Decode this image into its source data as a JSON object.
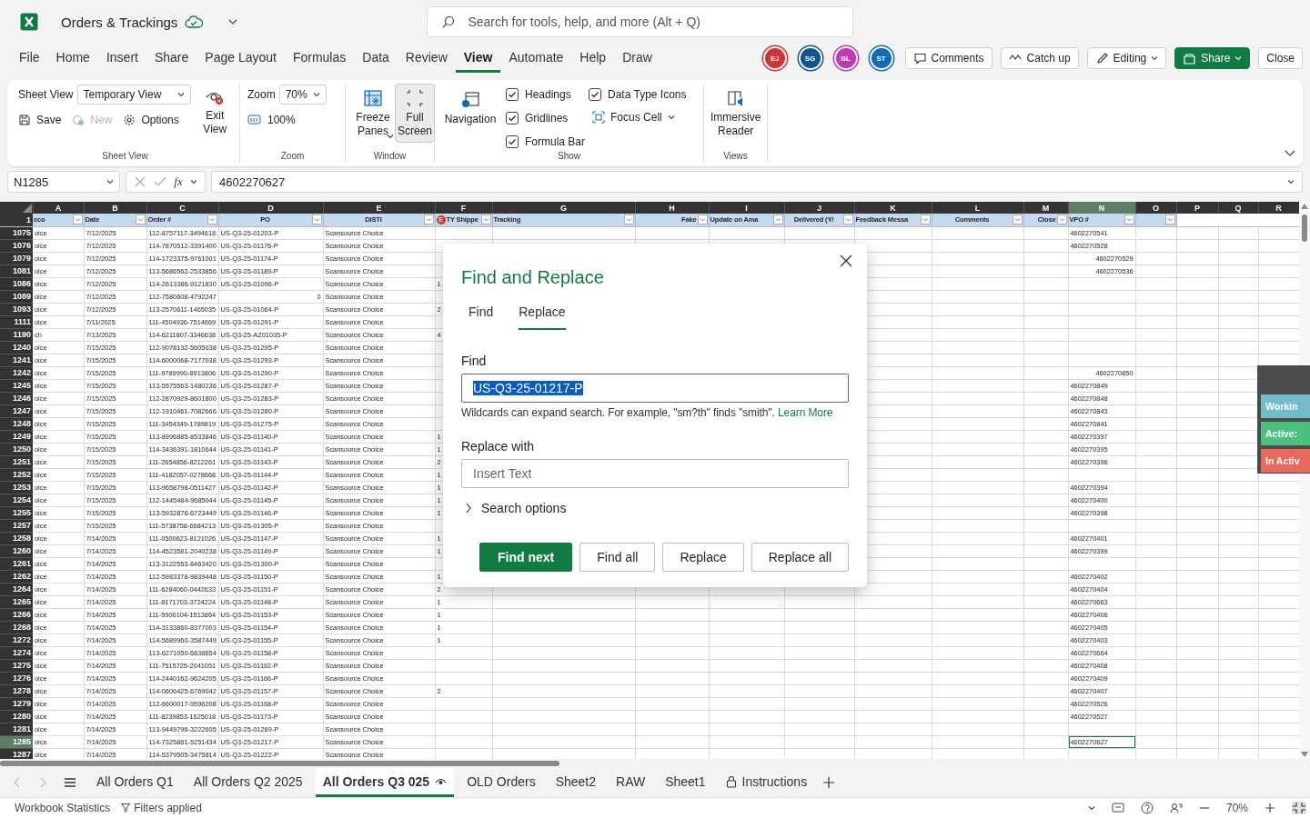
{
  "app_bar": {
    "title": "Orders & Trackings",
    "search": {
      "placeholder": "Search for tools, help, and more (Alt + Q)"
    }
  },
  "menu": [
    {
      "label": "File",
      "selected": false
    },
    {
      "label": "Home",
      "selected": false
    },
    {
      "label": "Insert",
      "selected": false
    },
    {
      "label": "Share",
      "selected": false
    },
    {
      "label": "Page Layout",
      "selected": false
    },
    {
      "label": "Formulas",
      "selected": false
    },
    {
      "label": "Data",
      "selected": false
    },
    {
      "label": "Review",
      "selected": false
    },
    {
      "label": "View",
      "selected": true
    },
    {
      "label": "Automate",
      "selected": false
    },
    {
      "label": "Help",
      "selected": false
    },
    {
      "label": "Draw",
      "selected": false
    }
  ],
  "collaborators": [
    {
      "initials": "EJ",
      "color": "#d13438"
    },
    {
      "initials": "SG",
      "color": "#0f548c"
    },
    {
      "initials": "BL",
      "color": "#c239b3"
    },
    {
      "initials": "ST",
      "color": "#0f6cbd"
    }
  ],
  "header_buttons": [
    {
      "label": "Comments",
      "kind": "comments"
    },
    {
      "label": "Catch up",
      "kind": "catch_up"
    },
    {
      "label": "Editing",
      "kind": "editing"
    },
    {
      "label": "Share",
      "kind": "share"
    },
    {
      "label": "Close",
      "kind": "close"
    }
  ],
  "ribbon": {
    "sheet_view": {
      "label": "Sheet View",
      "view_label": "Sheet View",
      "view": "Temporary View",
      "actions": [
        {
          "label": "Save",
          "kind": "save",
          "disabled": false
        },
        {
          "label": "New",
          "kind": "new",
          "disabled": true
        },
        {
          "label": "Options",
          "kind": "options",
          "disabled": false
        }
      ],
      "exit": "Exit View"
    },
    "zoom": {
      "label": "Zoom",
      "zoom_label": "Zoom",
      "value": "70%",
      "reset": "100%"
    },
    "window": {
      "label": "Window",
      "items": [
        {
          "label": "Freeze Panes",
          "kind": "freeze",
          "selected": false
        },
        {
          "label": "Full Screen",
          "kind": "fullscreen",
          "selected": true
        }
      ]
    },
    "show": {
      "label": "Show",
      "navigation": "Navigation",
      "options": [
        {
          "label": "Headings",
          "checked": true
        },
        {
          "label": "Gridlines",
          "checked": true
        },
        {
          "label": "Formula Bar",
          "checked": true
        },
        {
          "label": "Data Type Icons",
          "checked": true
        }
      ],
      "focus_cell": "Focus Cell"
    },
    "views": {
      "label": "Views",
      "item": "Immersive Reader"
    }
  },
  "formula_bar": {
    "name_box": "N1285",
    "function_label": "fx",
    "value": "4602270627"
  },
  "sheet": {
    "header_row_number": "1",
    "presence_badge": {
      "initials": "E",
      "color": "#d13438"
    },
    "columns": [
      {
        "letter": "A",
        "header": "cco",
        "centered": false,
        "right_aligned": false,
        "filter": true,
        "selected": false
      },
      {
        "letter": "B",
        "header": "Date",
        "centered": false,
        "right_aligned": false,
        "filter": true,
        "selected": false
      },
      {
        "letter": "C",
        "header": "Order #",
        "centered": false,
        "right_aligned": false,
        "filter": true,
        "selected": false
      },
      {
        "letter": "D",
        "header": "PO",
        "centered": true,
        "right_aligned": false,
        "filter": true,
        "selected": false
      },
      {
        "letter": "E",
        "header": "DISTI",
        "centered": true,
        "right_aligned": false,
        "filter": true,
        "selected": false
      },
      {
        "letter": "F",
        "header": "TY Shippe",
        "centered": false,
        "right_aligned": false,
        "filter": true,
        "selected": false
      },
      {
        "letter": "G",
        "header": "Tracking",
        "centered": false,
        "right_aligned": false,
        "filter": true,
        "selected": false
      },
      {
        "letter": "H",
        "header": "Fake",
        "centered": false,
        "right_aligned": true,
        "filter": true,
        "selected": false
      },
      {
        "letter": "I",
        "header": "Update on Ama",
        "centered": false,
        "right_aligned": false,
        "filter": true,
        "selected": false
      },
      {
        "letter": "J",
        "header": "Delivered (Y/",
        "centered": true,
        "right_aligned": false,
        "filter": true,
        "selected": false
      },
      {
        "letter": "K",
        "header": "Feedback Messa",
        "centered": false,
        "right_aligned": false,
        "filter": true,
        "selected": false
      },
      {
        "letter": "L",
        "header": "Comments",
        "centered": true,
        "right_aligned": false,
        "filter": true,
        "selected": false
      },
      {
        "letter": "M",
        "header": "Close",
        "centered": false,
        "right_aligned": true,
        "filter": true,
        "selected": false
      },
      {
        "letter": "N",
        "header": "VPO #",
        "centered": false,
        "right_aligned": false,
        "filter": true,
        "selected": true
      },
      {
        "letter": "O",
        "filter": true,
        "selected": false
      },
      {
        "letter": "P",
        "filter": false,
        "selected": false
      },
      {
        "letter": "Q",
        "filter": false,
        "selected": false
      },
      {
        "letter": "R",
        "filter": false,
        "selected": false
      }
    ],
    "rows": [
      {
        "number": "1075",
        "selected": false,
        "cells": {
          "A": "oice",
          "B": "7/12/2025",
          "C": "112-8757117-3494618",
          "D": "US-Q3-25-01203-P",
          "E": "Scansource Choice",
          "N": "4602270541"
        }
      },
      {
        "number": "1076",
        "selected": false,
        "cells": {
          "A": "oice",
          "B": "7/12/2025",
          "C": "114-7870512-3391400",
          "D": "US-Q3-25-01176-P",
          "E": "Scansource Choice",
          "N": "4602270528"
        }
      },
      {
        "number": "1079",
        "selected": false,
        "cells": {
          "A": "oice",
          "B": "7/12/2025",
          "C": "114-1723375-9761001",
          "D": "US-Q3-25-01174-P",
          "E": "Scansource Choice",
          "N": {
            "text": "4602270529",
            "right_aligned": true
          }
        }
      },
      {
        "number": "1081",
        "selected": false,
        "cells": {
          "A": "oice",
          "B": "7/12/2025",
          "C": "113-5686562-2533856",
          "D": "US-Q3-25-01189-P",
          "E": "Scansource Choice",
          "N": {
            "text": "4602270536",
            "right_aligned": true
          }
        }
      },
      {
        "number": "1086",
        "selected": false,
        "cells": {
          "A": "oice",
          "B": "7/12/2025",
          "C": "114-2613386-9121830",
          "D": "US-Q3-25-01096-P",
          "E": "Scansource Choice",
          "F": "1"
        }
      },
      {
        "number": "1089",
        "selected": false,
        "cells": {
          "A": "oice",
          "B": "7/12/2025",
          "C": "112-7580608-4792247",
          "D": {
            "text": "0",
            "right_aligned": true
          },
          "E": "Scansource Choice"
        }
      },
      {
        "number": "1093",
        "selected": false,
        "cells": {
          "A": "oice",
          "B": "7/12/2025",
          "C": "113-2570611-1465035",
          "D": "US-Q3-25-01064-P",
          "E": "Scansource Choice",
          "F": "2"
        }
      },
      {
        "number": "1111",
        "selected": false,
        "cells": {
          "A": "oice",
          "B": "7/11/2025",
          "C": "111-4504936-7514669",
          "D": "US-Q3-25-01291-P",
          "E": "Scansource Choice"
        }
      },
      {
        "number": "1190",
        "selected": false,
        "cells": {
          "A": "ch",
          "B": "7/13/2025",
          "C": "114-6211807-3346638",
          "D": "US-Q3-25-AZ01035-P",
          "E": "Scansource Choice",
          "F": "4"
        }
      },
      {
        "number": "1240",
        "selected": false,
        "cells": {
          "A": "oice",
          "B": "7/15/2025",
          "C": "112-9078132-5605038",
          "D": "US-Q3-25-01295-P",
          "E": "Scansource Choice"
        }
      },
      {
        "number": "1241",
        "selected": false,
        "cells": {
          "A": "oice",
          "B": "7/15/2025",
          "C": "114-6000068-7177038",
          "D": "US-Q3-25-01293-P",
          "E": "Scansource Choice"
        }
      },
      {
        "number": "1242",
        "selected": false,
        "cells": {
          "A": "oice",
          "B": "7/15/2025",
          "C": "111-9789990-8913806",
          "D": "US-Q3-25-01290-P",
          "E": "Scansource Choice",
          "N": {
            "text": "4602270850",
            "right_aligned": true
          }
        }
      },
      {
        "number": "1245",
        "selected": false,
        "cells": {
          "A": "oice",
          "B": "7/15/2025",
          "C": "113-5575563-1480236",
          "D": "US-Q3-25-01287-P",
          "E": "Scansource Choice",
          "N": "4602270849"
        }
      },
      {
        "number": "1246",
        "selected": false,
        "cells": {
          "A": "oice",
          "B": "7/15/2025",
          "C": "112-2870929-8601800",
          "D": "US-Q3-25-01283-P",
          "E": "Scansource Choice",
          "N": "4602270848"
        }
      },
      {
        "number": "1247",
        "selected": false,
        "cells": {
          "A": "oice",
          "B": "7/15/2025",
          "C": "112-1910461-7082666",
          "D": "US-Q3-25-01280-P",
          "E": "Scansource Choice",
          "N": "4602270843"
        }
      },
      {
        "number": "1248",
        "selected": false,
        "cells": {
          "A": "oice",
          "B": "7/15/2025",
          "C": "111-3454349-1789819",
          "D": "US-Q3-25-01275-P",
          "E": "Scansource Choice",
          "N": "4602270841"
        }
      },
      {
        "number": "1249",
        "selected": false,
        "cells": {
          "A": "oice",
          "B": "7/15/2025",
          "C": "113-8996885-8533846",
          "D": "US-Q3-25-01140-P",
          "E": "Scansource Choice",
          "F": "1",
          "N": "4602270397"
        }
      },
      {
        "number": "1250",
        "selected": false,
        "cells": {
          "A": "oice",
          "B": "7/15/2025",
          "C": "114-3436391-1810644",
          "D": "US-Q3-25-01141-P",
          "E": "Scansource Choice",
          "F": "1",
          "N": "4602270395"
        }
      },
      {
        "number": "1251",
        "selected": false,
        "cells": {
          "A": "oice",
          "B": "7/15/2025",
          "C": "111-2654856-8212261",
          "D": "US-Q3-25-01143-P",
          "E": "Scansource Choice",
          "F": "2",
          "N": "4602270396"
        }
      },
      {
        "number": "1252",
        "selected": false,
        "cells": {
          "A": "oice",
          "B": "7/15/2025",
          "C": "111-4182057-0278668",
          "D": "US-Q3-25-01144-P",
          "E": "Scansource Choice",
          "F": "1"
        }
      },
      {
        "number": "1253",
        "selected": false,
        "cells": {
          "A": "oice",
          "B": "7/15/2025",
          "C": "113-9658798-0511427",
          "D": "US-Q3-25-01142-P",
          "E": "Scansource Choice",
          "F": "1",
          "N": "4602270394"
        }
      },
      {
        "number": "1254",
        "selected": false,
        "cells": {
          "A": "oice",
          "B": "7/15/2025",
          "C": "112-1445484-9685044",
          "D": "US-Q3-25-01145-P",
          "E": "Scansource Choice",
          "F": "1",
          "N": "4602270400"
        }
      },
      {
        "number": "1255",
        "selected": false,
        "cells": {
          "A": "oice",
          "B": "7/15/2025",
          "C": "113-5932876-6723449",
          "D": "US-Q3-25-01146-P",
          "E": "Scansource Choice",
          "F": "1",
          "N": "4602270398"
        }
      },
      {
        "number": "1257",
        "selected": false,
        "cells": {
          "A": "oice",
          "B": "7/15/2025",
          "C": "111-5738758-6684213",
          "D": "US-Q3-25-01305-P",
          "E": "Scansource Choice"
        }
      },
      {
        "number": "1258",
        "selected": false,
        "cells": {
          "A": "oice",
          "B": "7/14/2025",
          "C": "111-0500623-8121026",
          "D": "US-Q3-25-01147-P",
          "E": "Scansource Choice",
          "F": "1",
          "N": "4602270401"
        }
      },
      {
        "number": "1260",
        "selected": false,
        "cells": {
          "A": "oice",
          "B": "7/14/2025",
          "C": "114-4523581-2040238",
          "D": "US-Q3-25-01149-P",
          "E": "Scansource Choice",
          "F": "1",
          "N": "4602270399"
        }
      },
      {
        "number": "1261",
        "selected": false,
        "cells": {
          "A": "oice",
          "B": "7/14/2025",
          "C": "113-3122553-8463420",
          "D": "US-Q3-25-01300-P",
          "E": "Scansource Choice"
        }
      },
      {
        "number": "1262",
        "selected": false,
        "cells": {
          "A": "oice",
          "B": "7/14/2025",
          "C": "112-5983378-9839448",
          "D": "US-Q3-25-01150-P",
          "E": "Scansource Choice",
          "F": "1",
          "N": "4602270402"
        }
      },
      {
        "number": "1264",
        "selected": false,
        "cells": {
          "A": "oice",
          "B": "7/14/2025",
          "C": "111-6284060-0442633",
          "D": "US-Q3-25-01151-P",
          "E": "Scansource Choice",
          "F": "2",
          "N": "4602270404"
        }
      },
      {
        "number": "1265",
        "selected": false,
        "cells": {
          "A": "oice",
          "B": "7/14/2025",
          "C": "111-8171703-3724224",
          "D": "US-Q3-25-01148-P",
          "E": "Scansource Choice",
          "F": "1",
          "N": "4602270663"
        }
      },
      {
        "number": "1266",
        "selected": false,
        "cells": {
          "A": "oice",
          "B": "7/14/2025",
          "C": "111-5900104-1513864",
          "D": "US-Q3-25-01153-P",
          "E": "Scansource Choice",
          "F": "1",
          "N": "4602270406"
        }
      },
      {
        "number": "1268",
        "selected": false,
        "cells": {
          "A": "oice",
          "B": "7/14/2025",
          "C": "114-3133860-8377003",
          "D": "US-Q3-25-01154-P",
          "E": "Scansource Choice",
          "F": "1",
          "N": "4602270405"
        }
      },
      {
        "number": "1272",
        "selected": false,
        "cells": {
          "A": "oice",
          "B": "7/14/2025",
          "C": "114-5689960-3587449",
          "D": "US-Q3-25-01155-P",
          "E": "Scansource Choice",
          "F": "1",
          "N": "4602270403"
        }
      },
      {
        "number": "1274",
        "selected": false,
        "cells": {
          "A": "oice",
          "B": "7/14/2025",
          "C": "113-6271050-6838654",
          "D": "US-Q3-25-01158-P",
          "E": "Scansource Choice",
          "N": "4602270664"
        }
      },
      {
        "number": "1275",
        "selected": false,
        "cells": {
          "A": "oice",
          "B": "7/14/2025",
          "C": "111-7515725-2041051",
          "D": "US-Q3-25-01162-P",
          "E": "Scansource Choice",
          "N": "4602270408"
        }
      },
      {
        "number": "1276",
        "selected": false,
        "cells": {
          "A": "oice",
          "B": "7/14/2025",
          "C": "114-2440162-9624205",
          "D": "US-Q3-25-01166-P",
          "E": "Scansource Choice",
          "N": "4602270409"
        }
      },
      {
        "number": "1278",
        "selected": false,
        "cells": {
          "A": "oice",
          "B": "7/14/2025",
          "C": "114-0606425-6769042",
          "D": "US-Q3-25-01157-P",
          "E": "Scansource Choice",
          "F": "2",
          "N": "4602270407"
        }
      },
      {
        "number": "1279",
        "selected": false,
        "cells": {
          "A": "oice",
          "B": "7/14/2025",
          "C": "112-6600017-9596208",
          "D": "US-Q3-25-01168-P",
          "E": "Scansource Choice",
          "N": "4602270526"
        }
      },
      {
        "number": "1280",
        "selected": false,
        "cells": {
          "A": "oice",
          "B": "7/14/2025",
          "C": "111-8239853-1625018",
          "D": "US-Q3-25-01173-P",
          "E": "Scansource Choice",
          "N": "4602270527"
        }
      },
      {
        "number": "1281",
        "selected": false,
        "cells": {
          "A": "oice",
          "B": "7/14/2025",
          "C": "113-9449796-3222605",
          "D": "US-Q3-25-01289-P",
          "E": "Scansource Choice"
        }
      },
      {
        "number": "1285",
        "selected": true,
        "cells": {
          "A": "oice",
          "B": "7/14/2025",
          "C": "114-7325861-5251434",
          "D": "US-Q3-25-01217-P",
          "E": "Scansource Choice",
          "N": "4602270627"
        }
      },
      {
        "number": "1287",
        "selected": false,
        "cells": {
          "A": "oice",
          "B": "7/14/2025",
          "C": "114-5379505-3475814",
          "D": "US-Q3-25-01222-P",
          "E": "Scansource Choice"
        }
      }
    ]
  },
  "dialog": {
    "title": "Find and Replace",
    "tabs": [
      {
        "label": "Find",
        "selected": false
      },
      {
        "label": "Replace",
        "selected": true
      }
    ],
    "find_label": "Find",
    "find_value": "US-Q3-25-01217-P",
    "hint": "Wildcards can expand search. For example, \"sm?th\" finds \"smith\". ",
    "hint_link": "Learn More",
    "replace_label": "Replace with",
    "replace_placeholder": "Insert Text",
    "search_options": "Search options",
    "buttons": [
      {
        "label": "Find next",
        "kind": "primary"
      },
      {
        "label": "Find all",
        "kind": "secondary"
      },
      {
        "label": "Replace",
        "kind": "secondary"
      },
      {
        "label": "Replace all",
        "kind": "secondary"
      }
    ]
  },
  "side_panel": {
    "buttons": [
      {
        "label": "Workin",
        "color": "#72bccb"
      },
      {
        "label": "Active:",
        "color": "#4cc17f"
      },
      {
        "label": "In Activ",
        "color": "#e8695d"
      }
    ]
  },
  "sheet_tabs": [
    {
      "label": "All Orders Q1",
      "kind": "plain",
      "selected": false
    },
    {
      "label": "All Orders Q2 2025",
      "kind": "plain",
      "selected": false
    },
    {
      "label": "All Orders Q3 025",
      "kind": "watched",
      "selected": true
    },
    {
      "label": "OLD Orders",
      "kind": "plain",
      "selected": false
    },
    {
      "label": "Sheet2",
      "kind": "plain",
      "selected": false
    },
    {
      "label": "RAW",
      "kind": "plain",
      "selected": false
    },
    {
      "label": "Sheet1",
      "kind": "plain",
      "selected": false
    },
    {
      "label": "Instructions",
      "kind": "locked",
      "selected": false
    }
  ],
  "status_bar": {
    "items": [
      {
        "label": "Workbook Statistics",
        "kind": "plain"
      },
      {
        "label": "Filters applied",
        "kind": "filter"
      }
    ],
    "zoom": "70%"
  }
}
